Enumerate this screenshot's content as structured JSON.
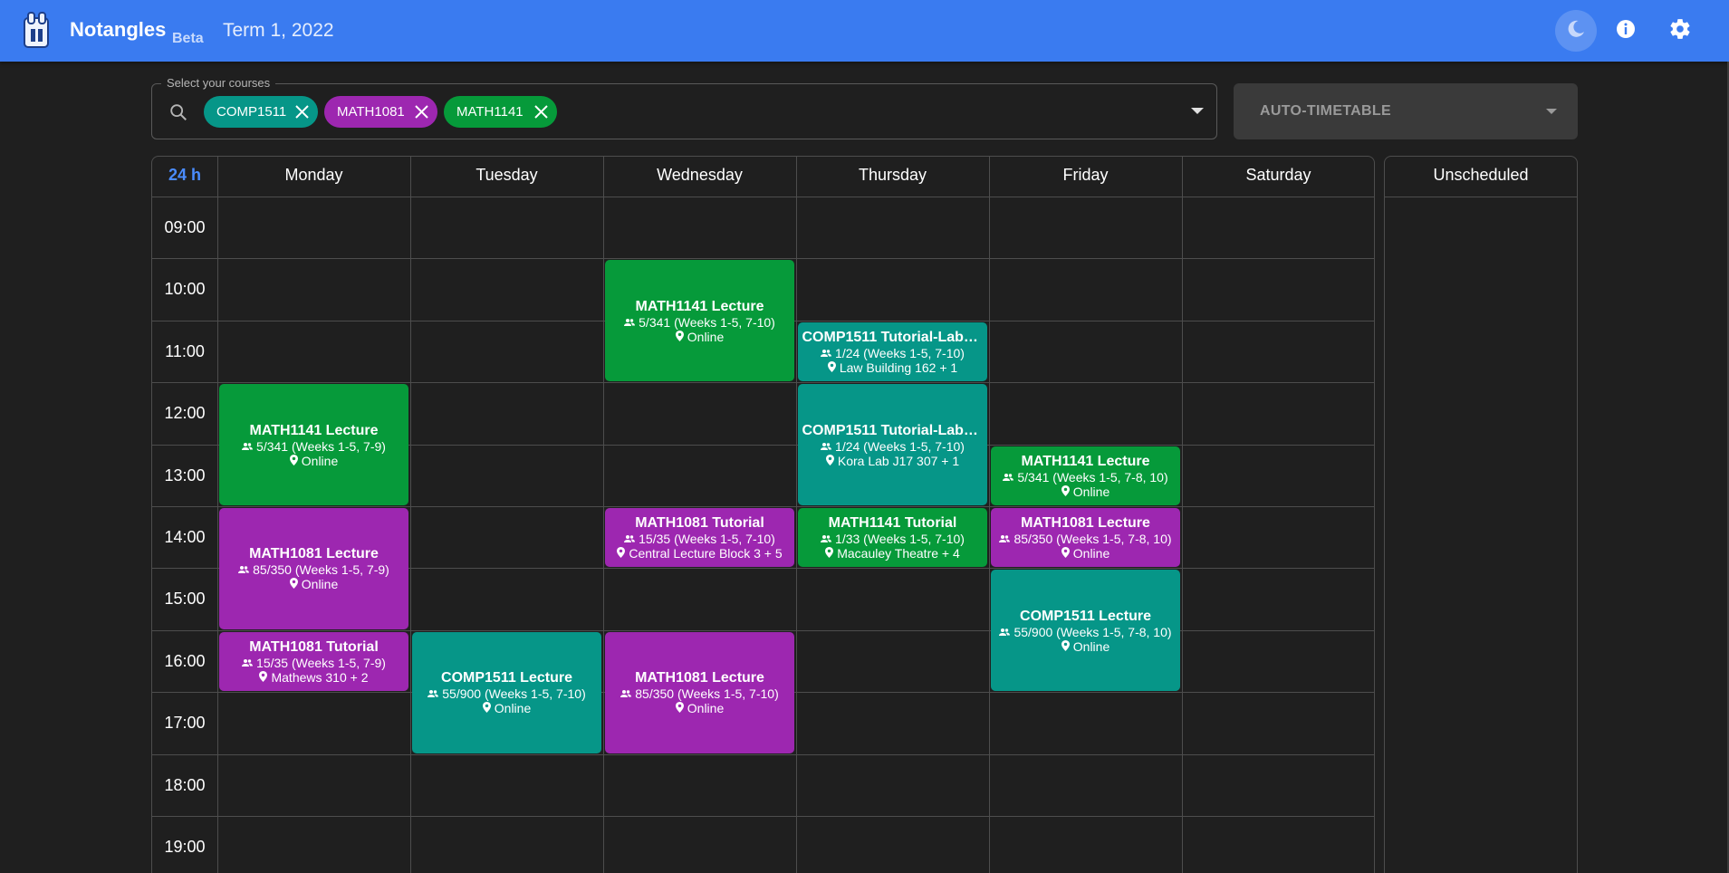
{
  "header": {
    "app_name": "Notangles",
    "beta_label": "Beta",
    "term": "Term 1, 2022"
  },
  "course_select": {
    "legend": "Select your courses",
    "chips": [
      {
        "code": "COMP1511",
        "color": "#069688"
      },
      {
        "code": "MATH1081",
        "color": "#9d27b0"
      },
      {
        "code": "MATH1141",
        "color": "#069a3a"
      }
    ]
  },
  "auto_timetable": {
    "label": "AUTO-TIMETABLE"
  },
  "timetable": {
    "toggle_label": "24 h",
    "days": [
      "Monday",
      "Tuesday",
      "Wednesday",
      "Thursday",
      "Friday",
      "Saturday"
    ],
    "times": [
      "09:00",
      "10:00",
      "11:00",
      "12:00",
      "13:00",
      "14:00",
      "15:00",
      "16:00",
      "17:00",
      "18:00",
      "19:00"
    ],
    "unscheduled_label": "Unscheduled"
  },
  "colors": {
    "COMP1511": "#069688",
    "MATH1081": "#9d27b0",
    "MATH1141": "#069a3a",
    "header": "#3a7bf0"
  },
  "events": [
    {
      "course": "MATH1141",
      "title": "MATH1141 Lecture",
      "enrol": "5/341 (Weeks 1-5, 7-10)",
      "location": "Online",
      "day": "Wednesday",
      "start": "10:00",
      "end": "12:00"
    },
    {
      "course": "COMP1511",
      "title": "COMP1511 Tutorial-Labo…",
      "enrol": "1/24 (Weeks 1-5, 7-10)",
      "location": "Law Building 162 + 1",
      "day": "Thursday",
      "start": "11:00",
      "end": "12:00"
    },
    {
      "course": "MATH1141",
      "title": "MATH1141 Lecture",
      "enrol": "5/341 (Weeks 1-5, 7-9)",
      "location": "Online",
      "day": "Monday",
      "start": "12:00",
      "end": "14:00"
    },
    {
      "course": "COMP1511",
      "title": "COMP1511 Tutorial-Labo…",
      "enrol": "1/24 (Weeks 1-5, 7-10)",
      "location": "Kora Lab J17 307 + 1",
      "day": "Thursday",
      "start": "12:00",
      "end": "14:00"
    },
    {
      "course": "MATH1141",
      "title": "MATH1141 Lecture",
      "enrol": "5/341 (Weeks 1-5, 7-8, 10)",
      "location": "Online",
      "day": "Friday",
      "start": "13:00",
      "end": "14:00"
    },
    {
      "course": "MATH1081",
      "title": "MATH1081 Lecture",
      "enrol": "85/350 (Weeks 1-5, 7-9)",
      "location": "Online",
      "day": "Monday",
      "start": "14:00",
      "end": "16:00"
    },
    {
      "course": "MATH1081",
      "title": "MATH1081 Tutorial",
      "enrol": "15/35 (Weeks 1-5, 7-10)",
      "location": "Central Lecture Block 3 + 5",
      "day": "Wednesday",
      "start": "14:00",
      "end": "15:00"
    },
    {
      "course": "MATH1141",
      "title": "MATH1141 Tutorial",
      "enrol": "1/33 (Weeks 1-5, 7-10)",
      "location": "Macauley Theatre + 4",
      "day": "Thursday",
      "start": "14:00",
      "end": "15:00"
    },
    {
      "course": "MATH1081",
      "title": "MATH1081 Lecture",
      "enrol": "85/350 (Weeks 1-5, 7-8, 10)",
      "location": "Online",
      "day": "Friday",
      "start": "14:00",
      "end": "15:00"
    },
    {
      "course": "COMP1511",
      "title": "COMP1511 Lecture",
      "enrol": "55/900 (Weeks 1-5, 7-8, 10)",
      "location": "Online",
      "day": "Friday",
      "start": "15:00",
      "end": "17:00"
    },
    {
      "course": "MATH1081",
      "title": "MATH1081 Tutorial",
      "enrol": "15/35 (Weeks 1-5, 7-9)",
      "location": "Mathews 310 + 2",
      "day": "Monday",
      "start": "16:00",
      "end": "17:00"
    },
    {
      "course": "COMP1511",
      "title": "COMP1511 Lecture",
      "enrol": "55/900 (Weeks 1-5, 7-10)",
      "location": "Online",
      "day": "Tuesday",
      "start": "16:00",
      "end": "18:00"
    },
    {
      "course": "MATH1081",
      "title": "MATH1081 Lecture",
      "enrol": "85/350 (Weeks 1-5, 7-10)",
      "location": "Online",
      "day": "Wednesday",
      "start": "16:00",
      "end": "18:00"
    }
  ]
}
